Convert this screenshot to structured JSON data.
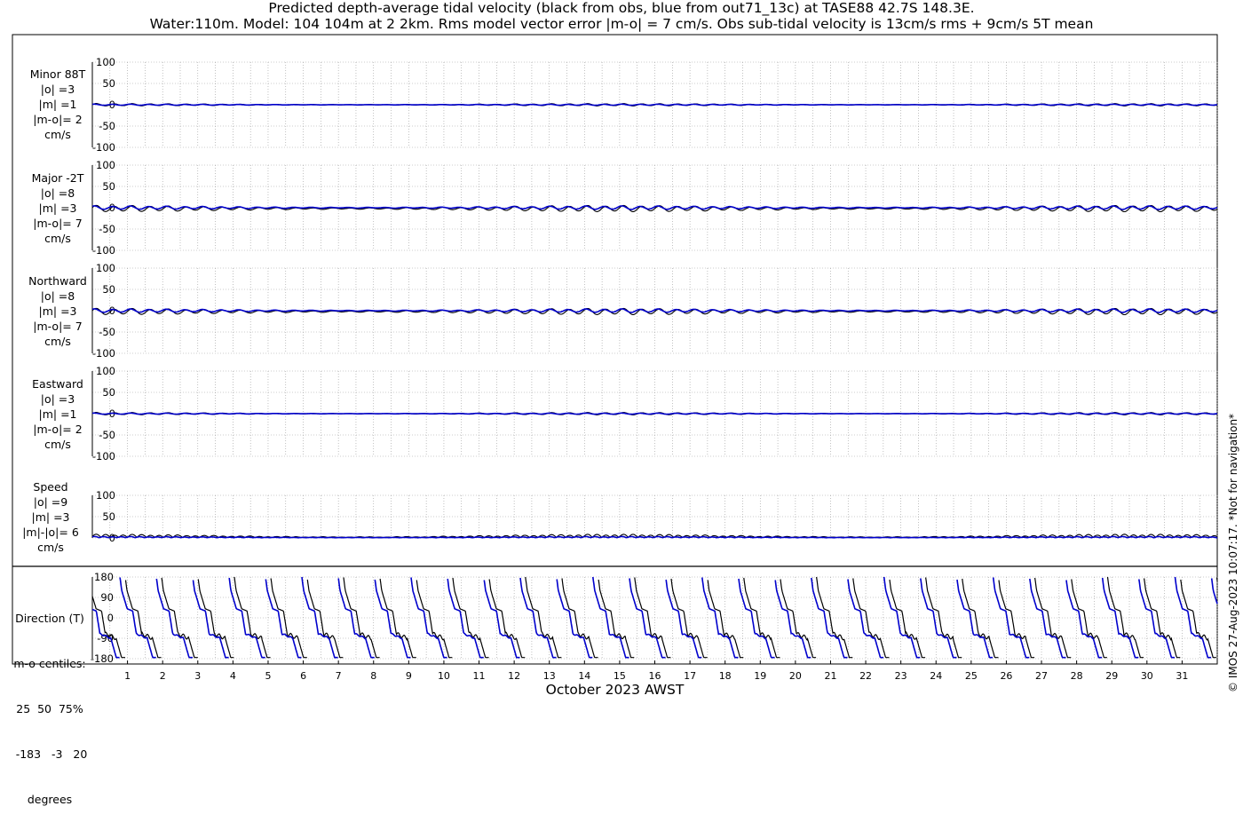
{
  "title_line1": "Predicted depth-average tidal velocity (black from obs, blue from out71_13c) at TASE88 42.7S 148.3E.",
  "title_line2": "Water:110m. Model: 104 104m at 2 2km. Rms model vector error |m-o| = 7 cm/s. Obs sub-tidal velocity is 13cm/s rms + 9cm/s 5T mean",
  "colors": {
    "obs": "#000000",
    "model": "#0000cc",
    "grid": "#999999"
  },
  "chart_data": {
    "type": "line",
    "xlabel": "October 2023 AWST",
    "x_ticks": [
      "1",
      "2",
      "3",
      "4",
      "5",
      "6",
      "7",
      "8",
      "9",
      "10",
      "11",
      "12",
      "13",
      "14",
      "15",
      "16",
      "17",
      "18",
      "19",
      "20",
      "21",
      "22",
      "23",
      "24",
      "25",
      "26",
      "27",
      "28",
      "29",
      "30",
      "31"
    ],
    "x_range_days": [
      0,
      32
    ],
    "panels": [
      {
        "label_lines": [
          "Minor 88T",
          "|o| =3",
          "|m| =1",
          "|m-o|= 2",
          "cm/s"
        ],
        "yticks": [
          "100",
          "50",
          "0",
          "-50",
          "-100"
        ],
        "ylim": [
          -100,
          100
        ],
        "obs_amplitude": 3,
        "model_amplitude": 1
      },
      {
        "label_lines": [
          "Major -2T",
          "|o| =8",
          "|m| =3",
          "|m-o|= 7",
          "cm/s"
        ],
        "yticks": [
          "100",
          "50",
          "0",
          "-50",
          "-100"
        ],
        "ylim": [
          -100,
          100
        ],
        "obs_amplitude": 8,
        "model_amplitude": 3
      },
      {
        "label_lines": [
          "Northward",
          "|o| =8",
          "|m| =3",
          "|m-o|= 7",
          "cm/s"
        ],
        "yticks": [
          "100",
          "50",
          "0",
          "-50",
          "-100"
        ],
        "ylim": [
          -100,
          100
        ],
        "obs_amplitude": 8,
        "model_amplitude": 3
      },
      {
        "label_lines": [
          "Eastward",
          "|o| =3",
          "|m| =1",
          "|m-o|= 2",
          "cm/s"
        ],
        "yticks": [
          "100",
          "50",
          "0",
          "-50",
          "-100"
        ],
        "ylim": [
          -100,
          100
        ],
        "obs_amplitude": 3,
        "model_amplitude": 1
      },
      {
        "label_lines": [
          "Speed",
          "|o| =9",
          "|m| =3",
          "|m|-|o|= 6",
          "cm/s"
        ],
        "yticks": [
          "100",
          "50",
          "0"
        ],
        "ylim": [
          0,
          100
        ],
        "obs_amplitude": 9,
        "model_amplitude": 3
      }
    ],
    "direction_panel": {
      "label_lines": [
        "Direction (T)",
        "m-o centiles:",
        "25  50  75%",
        " -183   -3   20",
        "degrees"
      ],
      "yticks": [
        "180",
        "90",
        "0",
        "-90",
        "-180"
      ],
      "ylim": [
        -180,
        180
      ]
    }
  },
  "copyright": "© IMOS 27-Aug-2023 10:07:17. *Not for navigation*"
}
